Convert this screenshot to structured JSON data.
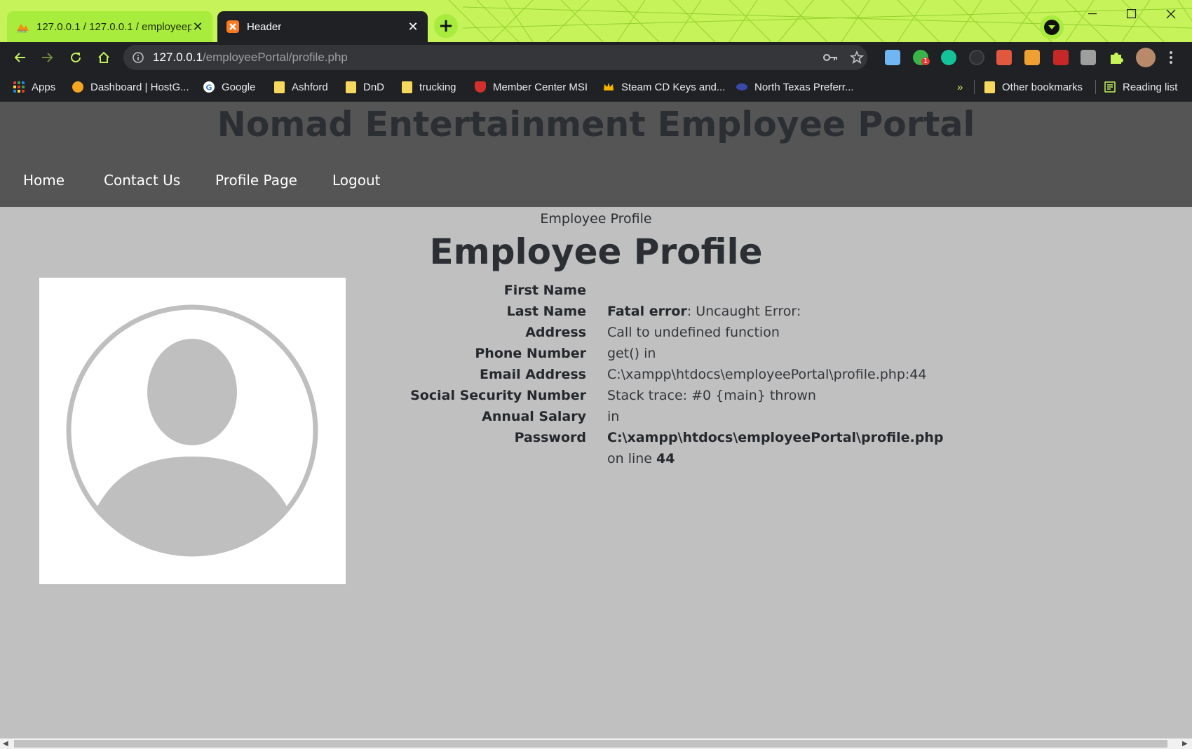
{
  "browser": {
    "tabs": [
      {
        "title": "127.0.0.1 / 127.0.0.1 / employeep",
        "favicon": "phpmyadmin-icon",
        "active": false
      },
      {
        "title": "Header",
        "favicon": "xampp-icon",
        "active": true
      }
    ],
    "address": {
      "host": "127.0.0.1",
      "path": "/employeePortal/profile.php"
    },
    "bookmarks": [
      {
        "label": "Apps",
        "icon": "apps-grid-icon"
      },
      {
        "label": "Dashboard | HostG...",
        "icon": "hostgator-icon"
      },
      {
        "label": "Google",
        "icon": "google-icon"
      },
      {
        "label": "Ashford",
        "icon": "folder-icon"
      },
      {
        "label": "DnD",
        "icon": "folder-icon"
      },
      {
        "label": "trucking",
        "icon": "folder-icon"
      },
      {
        "label": "Member Center MSI",
        "icon": "msi-icon"
      },
      {
        "label": "Steam CD Keys and...",
        "icon": "crown-icon"
      },
      {
        "label": "North Texas Preferr...",
        "icon": "site-icon"
      }
    ],
    "overflow_label": "»",
    "other_bookmarks": "Other bookmarks",
    "reading_list": "Reading list",
    "extension_badge": "1"
  },
  "site": {
    "title": "Nomad Entertainment Employee Portal",
    "nav": [
      "Home",
      "Contact Us",
      "Profile Page",
      "Logout"
    ]
  },
  "profile": {
    "breadcrumb": "Employee Profile",
    "heading": "Employee Profile",
    "labels": [
      "First Name",
      "Last Name",
      "Address",
      "Phone Number",
      "Email Address",
      "Social Security Number",
      "Annual Salary",
      "Password"
    ],
    "error": {
      "line1_bold": "Fatal error",
      "line1_rest": ": Uncaught Error:",
      "line2": "Call to undefined function",
      "line3": "get() in",
      "line4": "C:\\xampp\\htdocs\\employeePortal\\profile.php:44",
      "line5": "Stack trace: #0 {main} thrown",
      "line6": "in",
      "line7_bold": "C:\\xampp\\htdocs\\employeePortal\\profile.php",
      "line8_prefix": "on line ",
      "line8_bold": "44"
    }
  },
  "colors": {
    "tab_strip": "#c6f25a",
    "active_tab": "#a8ec3e",
    "header_bg": "#555555",
    "page_bg": "#c0c0c0"
  }
}
